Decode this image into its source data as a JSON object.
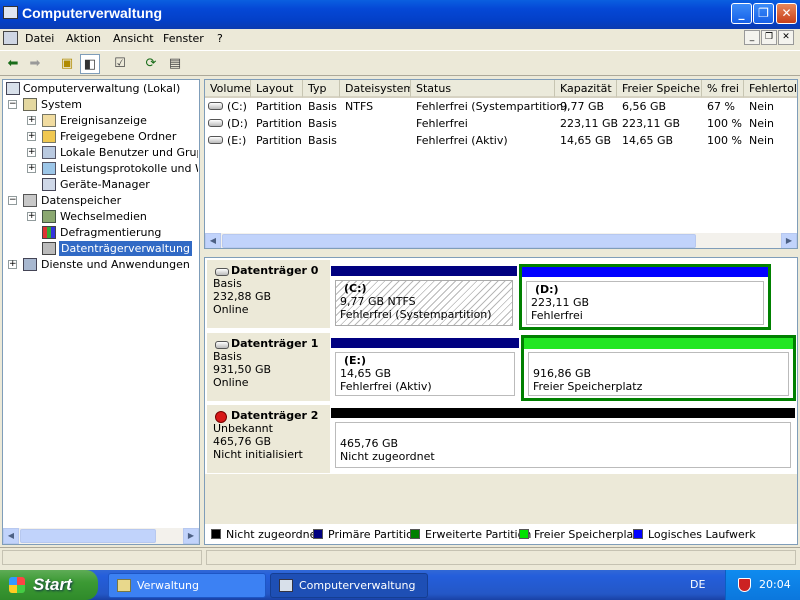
{
  "window": {
    "title": "Computerverwaltung"
  },
  "menubar": {
    "items": [
      "Datei",
      "Aktion",
      "Ansicht",
      "Fenster",
      "?"
    ]
  },
  "tree": {
    "root": "Computerverwaltung (Lokal)",
    "system": "System",
    "system_children": [
      "Ereignisanzeige",
      "Freigegebene Ordner",
      "Lokale Benutzer und Gruppen",
      "Leistungsprotokolle und Warnungen",
      "Geräte-Manager"
    ],
    "storage": "Datenspeicher",
    "storage_children": [
      "Wechselmedien",
      "Defragmentierung",
      "Datenträgerverwaltung"
    ],
    "services": "Dienste und Anwendungen"
  },
  "volumes": {
    "columns": [
      "Volume",
      "Layout",
      "Typ",
      "Dateisystem",
      "Status",
      "Kapazität",
      "Freier Speicher",
      "% frei",
      "Fehlertoleranz"
    ],
    "rows": [
      {
        "volume": "(C:)",
        "layout": "Partition",
        "typ": "Basis",
        "fs": "NTFS",
        "status": "Fehlerfrei (Systempartition)",
        "cap": "9,77 GB",
        "free": "6,56 GB",
        "pct": "67 %",
        "ft": "Nein"
      },
      {
        "volume": "(D:)",
        "layout": "Partition",
        "typ": "Basis",
        "fs": "",
        "status": "Fehlerfrei",
        "cap": "223,11 GB",
        "free": "223,11 GB",
        "pct": "100 %",
        "ft": "Nein"
      },
      {
        "volume": "(E:)",
        "layout": "Partition",
        "typ": "Basis",
        "fs": "",
        "status": "Fehlerfrei (Aktiv)",
        "cap": "14,65 GB",
        "free": "14,65 GB",
        "pct": "100 %",
        "ft": "Nein"
      }
    ]
  },
  "disks": [
    {
      "name": "Datenträger 0",
      "type": "Basis",
      "size": "232,88 GB",
      "state": "Online",
      "parts": [
        {
          "label": "(C:)",
          "line1": "9,77 GB NTFS",
          "line2": "Fehlerfrei (Systempartition)"
        },
        {
          "label": "(D:)",
          "line1": "223,11 GB",
          "line2": "Fehlerfrei"
        }
      ]
    },
    {
      "name": "Datenträger 1",
      "type": "Basis",
      "size": "931,50 GB",
      "state": "Online",
      "parts": [
        {
          "label": "(E:)",
          "line1": "14,65 GB",
          "line2": "Fehlerfrei (Aktiv)"
        },
        {
          "label": "",
          "line1": "916,86 GB",
          "line2": "Freier Speicherplatz"
        }
      ]
    },
    {
      "name": "Datenträger 2",
      "type": "Unbekannt",
      "size": "465,76 GB",
      "state": "Nicht initialisiert",
      "parts": [
        {
          "label": "",
          "line1": "465,76 GB",
          "line2": "Nicht zugeordnet"
        }
      ]
    }
  ],
  "legend": [
    {
      "label": "Nicht zugeordnet",
      "color": "#000000"
    },
    {
      "label": "Primäre Partition",
      "color": "#000080"
    },
    {
      "label": "Erweiterte Partition",
      "color": "#008000"
    },
    {
      "label": "Freier Speicherplatz",
      "color": "#00e000"
    },
    {
      "label": "Logisches Laufwerk",
      "color": "#0000ff"
    }
  ],
  "taskbar": {
    "start": "Start",
    "tasks": [
      "Verwaltung",
      "Computerverwaltung"
    ],
    "lang": "DE",
    "clock": "20:04"
  },
  "icons": [
    "back-arrow-icon",
    "forward-arrow-icon",
    "up-folder-icon",
    "show-hide-tree-icon",
    "properties-icon",
    "refresh-icon",
    "help-icon"
  ]
}
